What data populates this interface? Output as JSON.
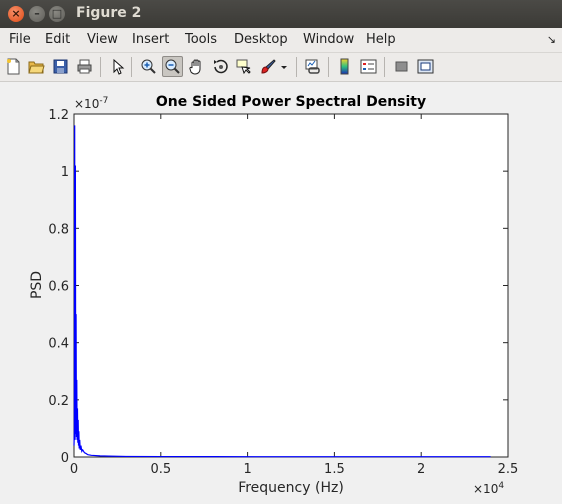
{
  "window": {
    "title": "Figure 2",
    "close_glyph": "×",
    "minimize_glyph": "–",
    "maximize_glyph": "□"
  },
  "menu": {
    "items": [
      {
        "label": "File"
      },
      {
        "label": "Edit"
      },
      {
        "label": "View"
      },
      {
        "label": "Insert"
      },
      {
        "label": "Tools"
      },
      {
        "label": "Desktop"
      },
      {
        "label": "Window"
      },
      {
        "label": "Help"
      }
    ],
    "dock_glyph": "↘"
  },
  "toolbar": {
    "buttons": [
      {
        "icon": "new-figure-icon"
      },
      {
        "icon": "open-file-icon"
      },
      {
        "icon": "save-icon"
      },
      {
        "icon": "print-icon"
      },
      {
        "icon": "edit-plot-arrow-icon"
      },
      {
        "icon": "zoom-in-icon"
      },
      {
        "icon": "zoom-out-icon",
        "active": true
      },
      {
        "icon": "pan-hand-icon"
      },
      {
        "icon": "rotate-3d-icon"
      },
      {
        "icon": "data-cursor-icon"
      },
      {
        "icon": "brush-icon"
      },
      {
        "icon": "brush-dropdown-icon"
      },
      {
        "icon": "link-plot-icon"
      },
      {
        "icon": "colorbar-icon"
      },
      {
        "icon": "legend-icon"
      },
      {
        "icon": "hide-plot-tools-icon"
      },
      {
        "icon": "show-plot-tools-icon"
      }
    ]
  },
  "chart_data": {
    "type": "line",
    "title": "One Sided Power Spectral Density",
    "xlabel": "Frequency (Hz)",
    "ylabel": "PSD",
    "x_exponent_label": "×10",
    "x_exponent": "4",
    "y_exponent_label": "×10",
    "y_exponent": "-7",
    "xlim": [
      0,
      25000
    ],
    "ylim": [
      0,
      1.2e-07
    ],
    "xticks": [
      0,
      5000,
      10000,
      15000,
      20000,
      25000
    ],
    "xtick_labels": [
      "0",
      "0.5",
      "1",
      "1.5",
      "2",
      "2.5"
    ],
    "yticks": [
      0,
      2e-08,
      4e-08,
      6e-08,
      8e-08,
      1e-07,
      1.2e-07
    ],
    "ytick_labels": [
      "0",
      "0.2",
      "0.4",
      "0.6",
      "0.8",
      "1",
      "1.2"
    ],
    "grid": false,
    "line_color": "#0000ff",
    "series": [
      {
        "x": [
          0,
          20,
          40,
          60,
          80,
          100,
          120,
          140,
          160,
          180,
          200,
          220,
          240,
          260,
          280,
          300,
          330,
          360,
          400,
          450,
          500,
          600,
          700,
          800,
          1000,
          1500,
          2000,
          3000,
          5000,
          8000,
          12000,
          16000,
          20000,
          24000
        ],
        "y": [
          4e-09,
          9e-09,
          1.16e-07,
          6e-09,
          1.02e-07,
          8e-09,
          5e-08,
          7e-09,
          2.7e-08,
          6e-09,
          1.7e-08,
          5e-09,
          1.3e-08,
          4e-09,
          9e-09,
          3e-09,
          6e-09,
          2.5e-09,
          4e-09,
          2e-09,
          2.5e-09,
          1.5e-09,
          1.2e-09,
          8e-10,
          6e-10,
          4e-10,
          3e-10,
          2e-10,
          1.5e-10,
          1.2e-10,
          1e-10,
          1e-10,
          1e-10,
          1e-10
        ]
      }
    ]
  }
}
